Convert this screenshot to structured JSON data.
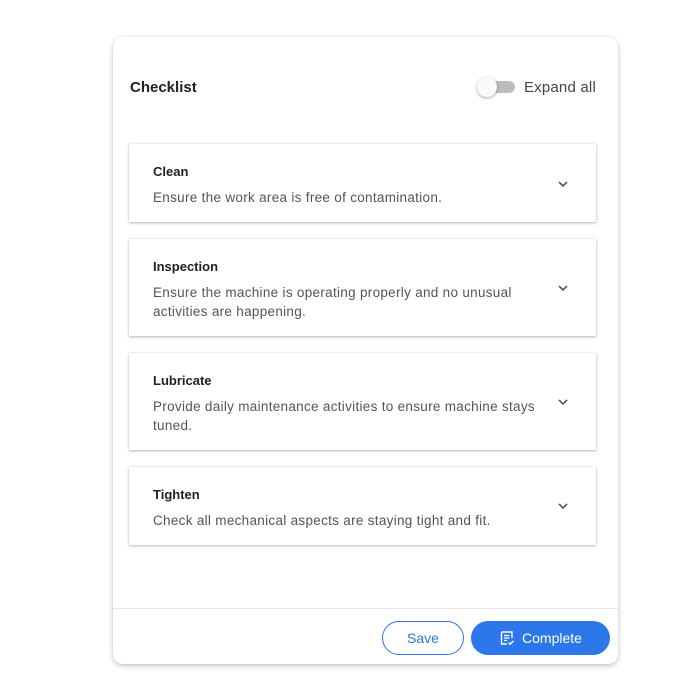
{
  "header": {
    "title": "Checklist",
    "expand_all_label": "Expand all",
    "expand_all_on": false
  },
  "items": [
    {
      "title": "Clean",
      "description": "Ensure the work area is free of contamination."
    },
    {
      "title": "Inspection",
      "description": "Ensure the machine is operating properly and no unusual activities are happening."
    },
    {
      "title": "Lubricate",
      "description": "Provide daily maintenance activities to ensure machine stays tuned."
    },
    {
      "title": "Tighten",
      "description": "Check all mechanical aspects are staying tight and fit."
    }
  ],
  "footer": {
    "save_label": "Save",
    "complete_label": "Complete"
  },
  "colors": {
    "accent": "#2c78ea",
    "toggle_track": "#bdbdbd"
  },
  "icons": {
    "chevron": "chevron-down-icon",
    "complete": "checklist-icon"
  }
}
